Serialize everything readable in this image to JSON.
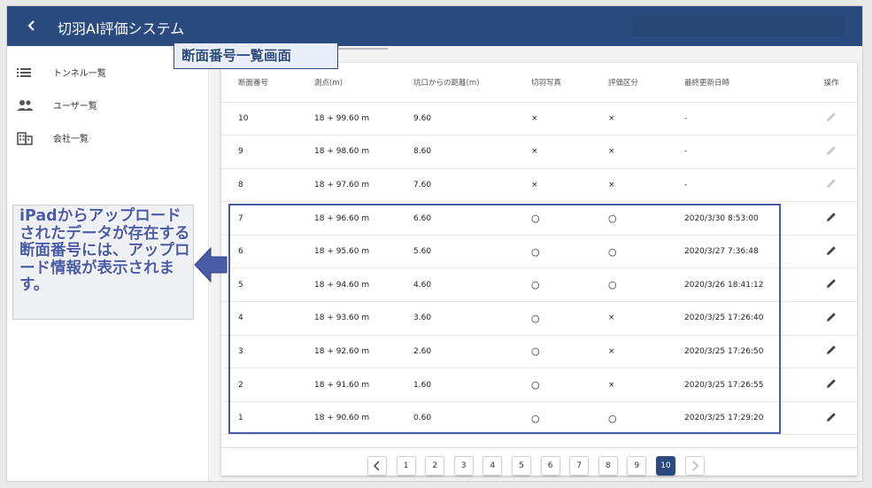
{
  "header": {
    "back_icon": "chevron-left-icon",
    "title": "切羽AI評価システム"
  },
  "sidebar": {
    "items": [
      {
        "label": "トンネル一覧",
        "icon": "list-icon"
      },
      {
        "label": "ユーザー覧",
        "icon": "people-icon"
      },
      {
        "label": "会社一覧",
        "icon": "building-icon"
      }
    ]
  },
  "table": {
    "headers": [
      "断面番号",
      "測点(m)",
      "坑口からの距離(m)",
      "切羽写真",
      "評価区分",
      "最終更新日時",
      "操作"
    ],
    "rows": [
      {
        "no": "10",
        "station": "18 + 99.60 m",
        "distance": "9.60",
        "photo": "×",
        "eval": "×",
        "updated": "-",
        "edit_enabled": false
      },
      {
        "no": "9",
        "station": "18 + 98.60 m",
        "distance": "8.60",
        "photo": "×",
        "eval": "×",
        "updated": "-",
        "edit_enabled": false
      },
      {
        "no": "8",
        "station": "18 + 97.60 m",
        "distance": "7.60",
        "photo": "×",
        "eval": "×",
        "updated": "-",
        "edit_enabled": false
      },
      {
        "no": "7",
        "station": "18 + 96.60 m",
        "distance": "6.60",
        "photo": "○",
        "eval": "○",
        "updated": "2020/3/30 8:53:00",
        "edit_enabled": true
      },
      {
        "no": "6",
        "station": "18 + 95.60 m",
        "distance": "5.60",
        "photo": "○",
        "eval": "○",
        "updated": "2020/3/27 7:36:48",
        "edit_enabled": true
      },
      {
        "no": "5",
        "station": "18 + 94.60 m",
        "distance": "4.60",
        "photo": "○",
        "eval": "○",
        "updated": "2020/3/26 18:41:12",
        "edit_enabled": true
      },
      {
        "no": "4",
        "station": "18 + 93.60 m",
        "distance": "3.60",
        "photo": "○",
        "eval": "×",
        "updated": "2020/3/25 17:26:40",
        "edit_enabled": true
      },
      {
        "no": "3",
        "station": "18 + 92.60 m",
        "distance": "2.60",
        "photo": "○",
        "eval": "×",
        "updated": "2020/3/25 17:26:50",
        "edit_enabled": true
      },
      {
        "no": "2",
        "station": "18 + 91.60 m",
        "distance": "1.60",
        "photo": "○",
        "eval": "×",
        "updated": "2020/3/25 17:26:55",
        "edit_enabled": true
      },
      {
        "no": "1",
        "station": "18 + 90.60 m",
        "distance": "0.60",
        "photo": "○",
        "eval": "○",
        "updated": "2020/3/25 17:29:20",
        "edit_enabled": true
      }
    ]
  },
  "pagination": {
    "prev_icon": "chevron-left-icon",
    "next_icon": "chevron-right-icon",
    "pages": [
      "1",
      "2",
      "3",
      "4",
      "5",
      "6",
      "7",
      "8",
      "9",
      "10"
    ],
    "current": "10"
  },
  "annotations": {
    "screen_label": "断面番号一覧画面",
    "note": "iPadからアップロードされたデータが存在する断面番号には、アップロード情報が表示されます。"
  },
  "colors": {
    "primary": "#2b4b7e",
    "annotation": "#4a5ba7"
  }
}
